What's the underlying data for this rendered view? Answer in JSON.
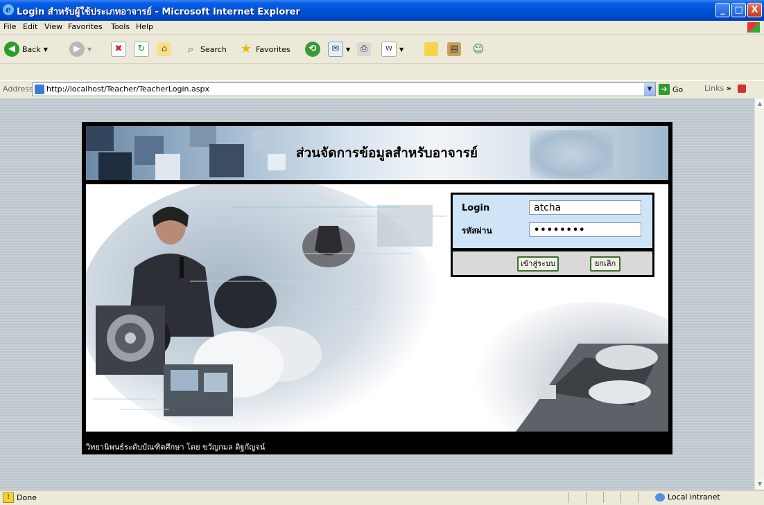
{
  "window": {
    "title": "Login สำหรับผู้ใช้ประเภทอาจารย์ - Microsoft Internet Explorer",
    "minimize": "_",
    "maximize": "□",
    "close": "X"
  },
  "menu": [
    "File",
    "Edit",
    "View",
    "Favorites",
    "Tools",
    "Help"
  ],
  "toolbar": {
    "back": "Back",
    "search": "Search",
    "favorites": "Favorites"
  },
  "address": {
    "label": "Address",
    "url": "http://localhost/Teacher/TeacherLogin.aspx",
    "go": "Go",
    "links": "Links"
  },
  "page": {
    "banner_title": "ส่วนจัดการข้อมูลสำหรับอาจารย์",
    "login_label": "Login",
    "login_value": "atcha",
    "password_label": "รหัสผ่าน",
    "password_value": "••••••••",
    "submit_label": "เข้าสู่ระบบ",
    "cancel_label": "ยกเลิก",
    "footer": "วิทยานิพนธ์ระดับบัณฑิตศึกษา โดย ขวัญกมล ดิฐกัญจน์"
  },
  "status": {
    "text": "Done",
    "zone": "Local intranet"
  }
}
